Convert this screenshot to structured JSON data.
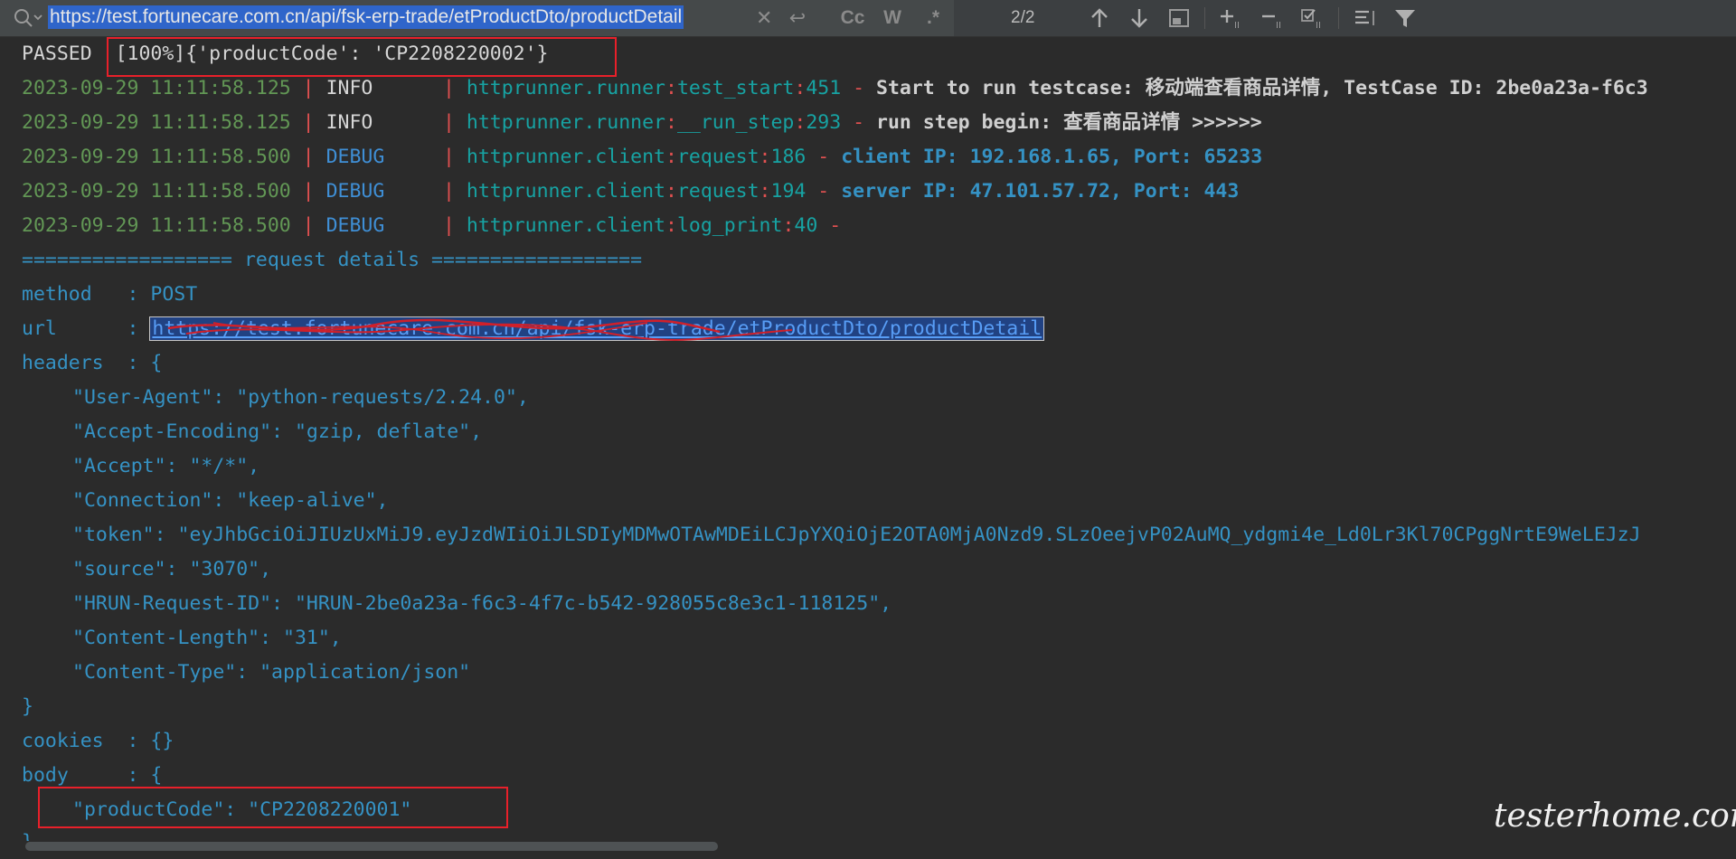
{
  "search": {
    "query": "https://test.fortunecare.com.cn/api/fsk-erp-trade/etProductDto/productDetail",
    "case_label": "Cc",
    "words_label": "W",
    "regex_label": ".*",
    "match_count": "2/2"
  },
  "console": {
    "passed": {
      "status": "PASSED",
      "progress": "[100%]",
      "params": "{'productCode': 'CP2208220002'}"
    },
    "logs": [
      {
        "time": "2023-09-29 11:11:58.125",
        "level": "INFO",
        "module": "httprunner.runner",
        "func": "test_start",
        "line": "451",
        "message": "Start to run testcase: 移动端查看商品详情, TestCase ID: 2be0a23a-f6c3"
      },
      {
        "time": "2023-09-29 11:11:58.125",
        "level": "INFO",
        "module": "httprunner.runner",
        "func": "__run_step",
        "line": "293",
        "message": "run step begin: 查看商品详情 >>>>>>"
      },
      {
        "time": "2023-09-29 11:11:58.500",
        "level": "DEBUG",
        "module": "httprunner.client",
        "func": "request",
        "line": "186",
        "message": "client IP: 192.168.1.65, Port: 65233"
      },
      {
        "time": "2023-09-29 11:11:58.500",
        "level": "DEBUG",
        "module": "httprunner.client",
        "func": "request",
        "line": "194",
        "message": "server IP: 47.101.57.72, Port: 443"
      },
      {
        "time": "2023-09-29 11:11:58.500",
        "level": "DEBUG",
        "module": "httprunner.client",
        "func": "log_print",
        "line": "40",
        "message": ""
      }
    ],
    "section_header": "================== request details ==================",
    "method_key": "method   ",
    "method_value": "POST",
    "url_key": "url      ",
    "url_value": "https://test.fortunecare.com.cn/api/fsk-erp-trade/etProductDto/productDetail",
    "headers_key": "headers  ",
    "headers": [
      "\"User-Agent\": \"python-requests/2.24.0\",",
      "\"Accept-Encoding\": \"gzip, deflate\",",
      "\"Accept\": \"*/*\",",
      "\"Connection\": \"keep-alive\",",
      "\"token\": \"eyJhbGciOiJIUzUxMiJ9.eyJzdWIiOiJLSDIyMDMwOTAwMDEiLCJpYXQiOjE2OTA0MjA0Nzd9.SLzOeejvP02AuMQ_ydgmi4e_Ld0Lr3Kl70CPggNrtE9WeLEJzJ",
      "\"source\": \"3070\",",
      "\"HRUN-Request-ID\": \"HRUN-2be0a23a-f6c3-4f7c-b542-928055c8e3c1-118125\",",
      "\"Content-Length\": \"31\",",
      "\"Content-Type\": \"application/json\""
    ],
    "close_brace": "}",
    "cookies_key": "cookies  ",
    "cookies_value": "{}",
    "body_key": "body     ",
    "body_line": "\"productCode\": \"CP2208220001\"",
    "body_close": "}"
  },
  "watermark": "testerhome.com",
  "colors": {
    "background": "#2b2b2b",
    "toolbar": "#3c3f41",
    "highlight_box": "#e8202a",
    "timestamp": "#629755",
    "debug": "#3f8fd6",
    "module": "#17a3a3"
  }
}
